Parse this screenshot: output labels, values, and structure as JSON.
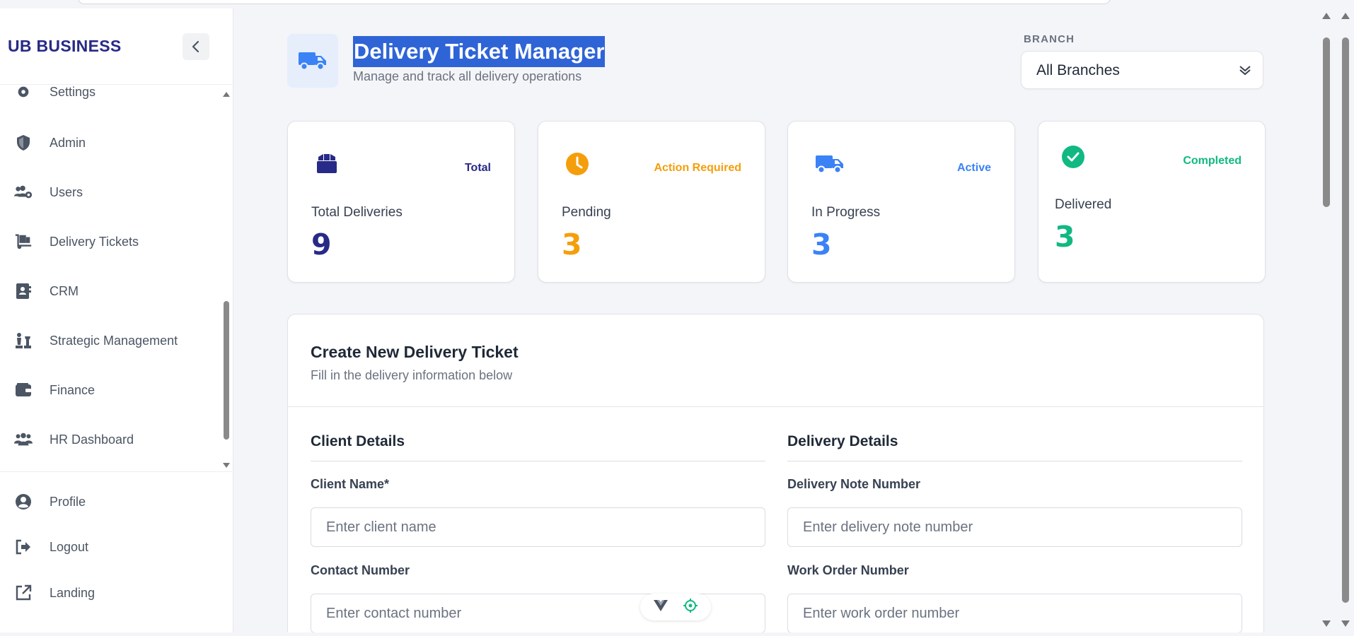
{
  "app": {
    "brand": "UB BUSINESS"
  },
  "sidebar": {
    "items": [
      {
        "label": "Settings",
        "icon": "gear-icon"
      },
      {
        "label": "Admin",
        "icon": "shield-icon"
      },
      {
        "label": "Users",
        "icon": "users-cog-icon"
      },
      {
        "label": "Delivery Tickets",
        "icon": "dolly-icon"
      },
      {
        "label": "CRM",
        "icon": "address-book-icon"
      },
      {
        "label": "Strategic Management",
        "icon": "chess-icon"
      },
      {
        "label": "Finance",
        "icon": "wallet-icon"
      },
      {
        "label": "HR Dashboard",
        "icon": "people-group-icon"
      }
    ],
    "footer": [
      {
        "label": "Profile",
        "icon": "user-circle-icon"
      },
      {
        "label": "Logout",
        "icon": "sign-out-icon"
      },
      {
        "label": "Landing",
        "icon": "external-link-icon"
      }
    ]
  },
  "header": {
    "title": "Delivery Ticket Manager",
    "subtitle": "Manage and track all delivery operations",
    "branch_label": "BRANCH",
    "branch_value": "All Branches"
  },
  "stats": [
    {
      "tag": "Total",
      "label": "Total Deliveries",
      "value": "9",
      "icon": "box-icon",
      "color": "#272a86"
    },
    {
      "tag": "Action Required",
      "label": "Pending",
      "value": "3",
      "icon": "clock-icon",
      "color": "#f59e0b"
    },
    {
      "tag": "Active",
      "label": "In Progress",
      "value": "3",
      "icon": "truck-icon",
      "color": "#3b82f6"
    },
    {
      "tag": "Completed",
      "label": "Delivered",
      "value": "3",
      "icon": "check-circle-icon",
      "color": "#10b981"
    }
  ],
  "form": {
    "title": "Create New Delivery Ticket",
    "subtitle": "Fill in the delivery information below",
    "client_section": "Client Details",
    "delivery_section": "Delivery Details",
    "client_name_label": "Client Name*",
    "client_name_placeholder": "Enter client name",
    "contact_number_label": "Contact Number",
    "contact_number_placeholder": "Enter contact number",
    "delivery_note_label": "Delivery Note Number",
    "delivery_note_placeholder": "Enter delivery note number",
    "work_order_label": "Work Order Number",
    "work_order_placeholder": "Enter work order number"
  }
}
